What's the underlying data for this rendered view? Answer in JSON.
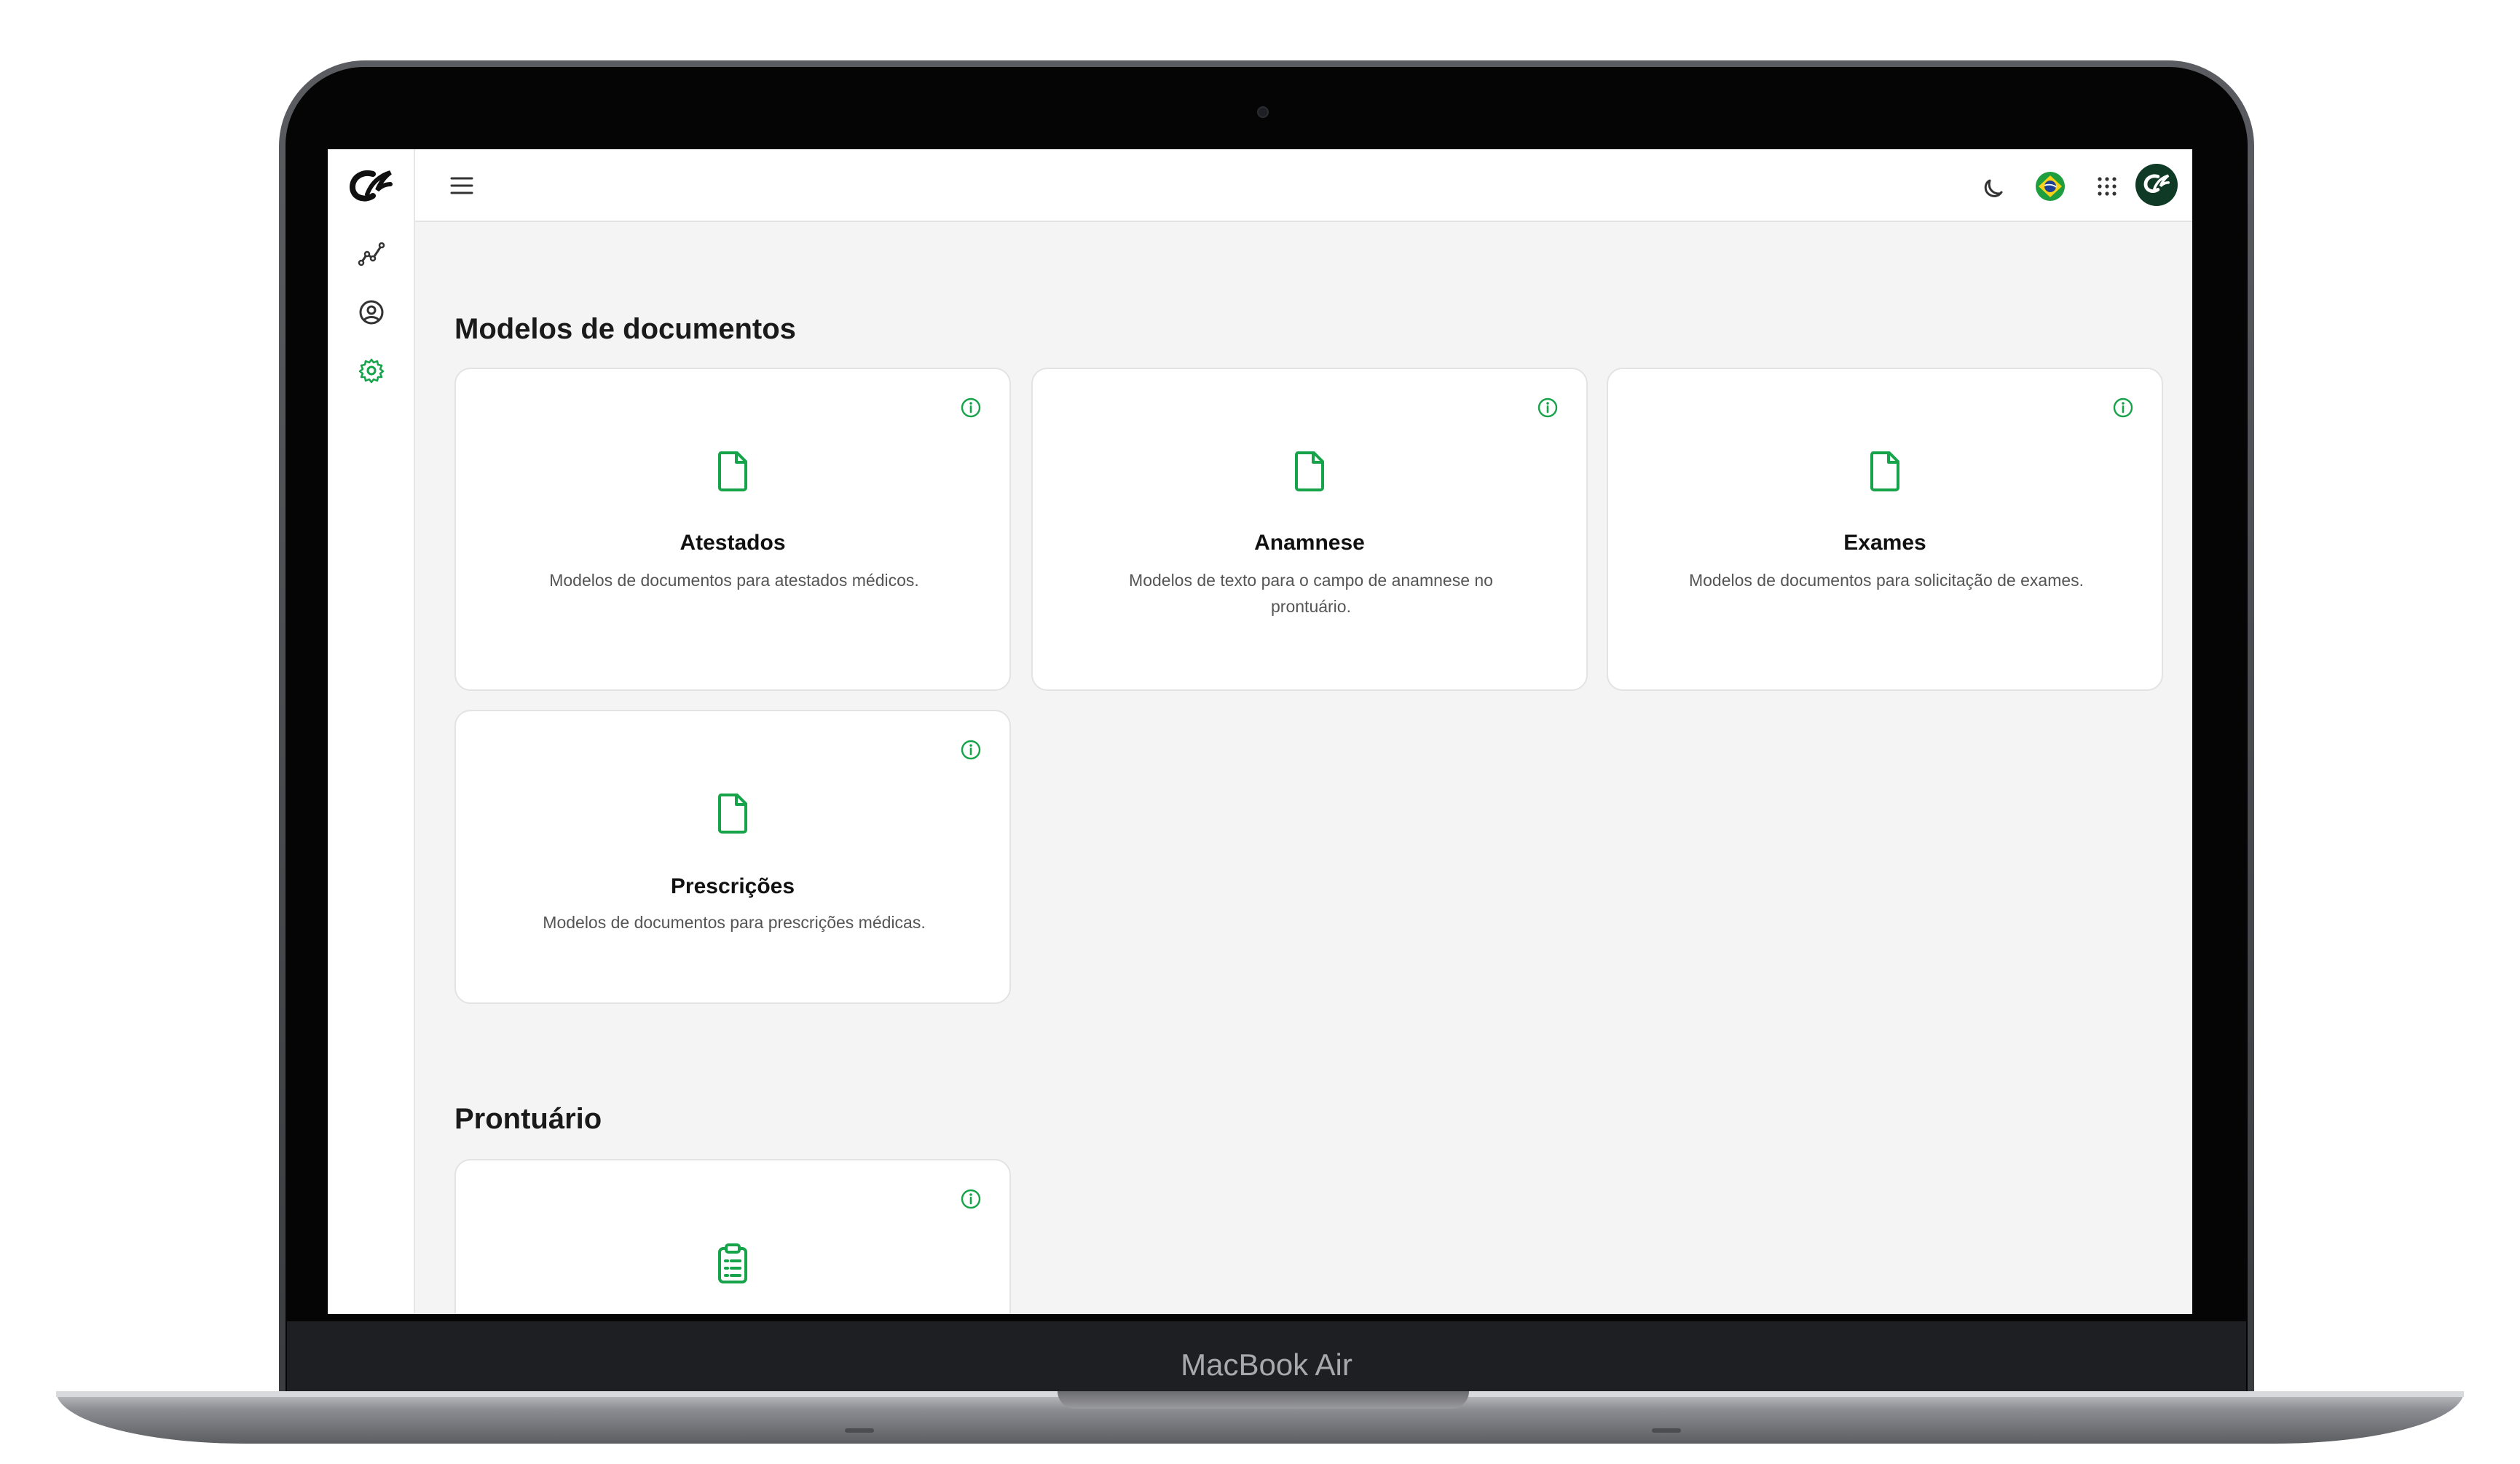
{
  "device": {
    "label": "MacBook Air"
  },
  "sidebar": {
    "items": [
      {
        "name": "dashboard",
        "icon": "chart-line-icon"
      },
      {
        "name": "profile",
        "icon": "user-circle-icon"
      },
      {
        "name": "settings",
        "icon": "gear-icon",
        "active": true
      }
    ]
  },
  "topbar": {
    "icons": [
      "menu-icon",
      "moon-icon",
      "brazil-flag-icon",
      "apps-grid-icon",
      "avatar-logo-icon"
    ]
  },
  "sections": [
    {
      "title": "Modelos de documentos",
      "cards": [
        {
          "title": "Atestados",
          "description": "Modelos de documentos para atestados médicos.",
          "icon": "document-icon"
        },
        {
          "title": "Anamnese",
          "description": "Modelos de texto para o campo de anamnese no prontuário.",
          "icon": "document-icon"
        },
        {
          "title": "Exames",
          "description": "Modelos de documentos para solicitação de exames.",
          "icon": "document-icon"
        },
        {
          "title": "Prescrições",
          "description": "Modelos de documentos para prescrições médicas.",
          "icon": "document-icon"
        }
      ]
    },
    {
      "title": "Prontuário",
      "cards": [
        {
          "title": "",
          "description": "",
          "icon": "clipboard-list-icon"
        }
      ]
    }
  ],
  "colors": {
    "accent": "#16a34a",
    "screen_bg": "#f4f4f4",
    "avatar_bg": "#0f3b26"
  }
}
